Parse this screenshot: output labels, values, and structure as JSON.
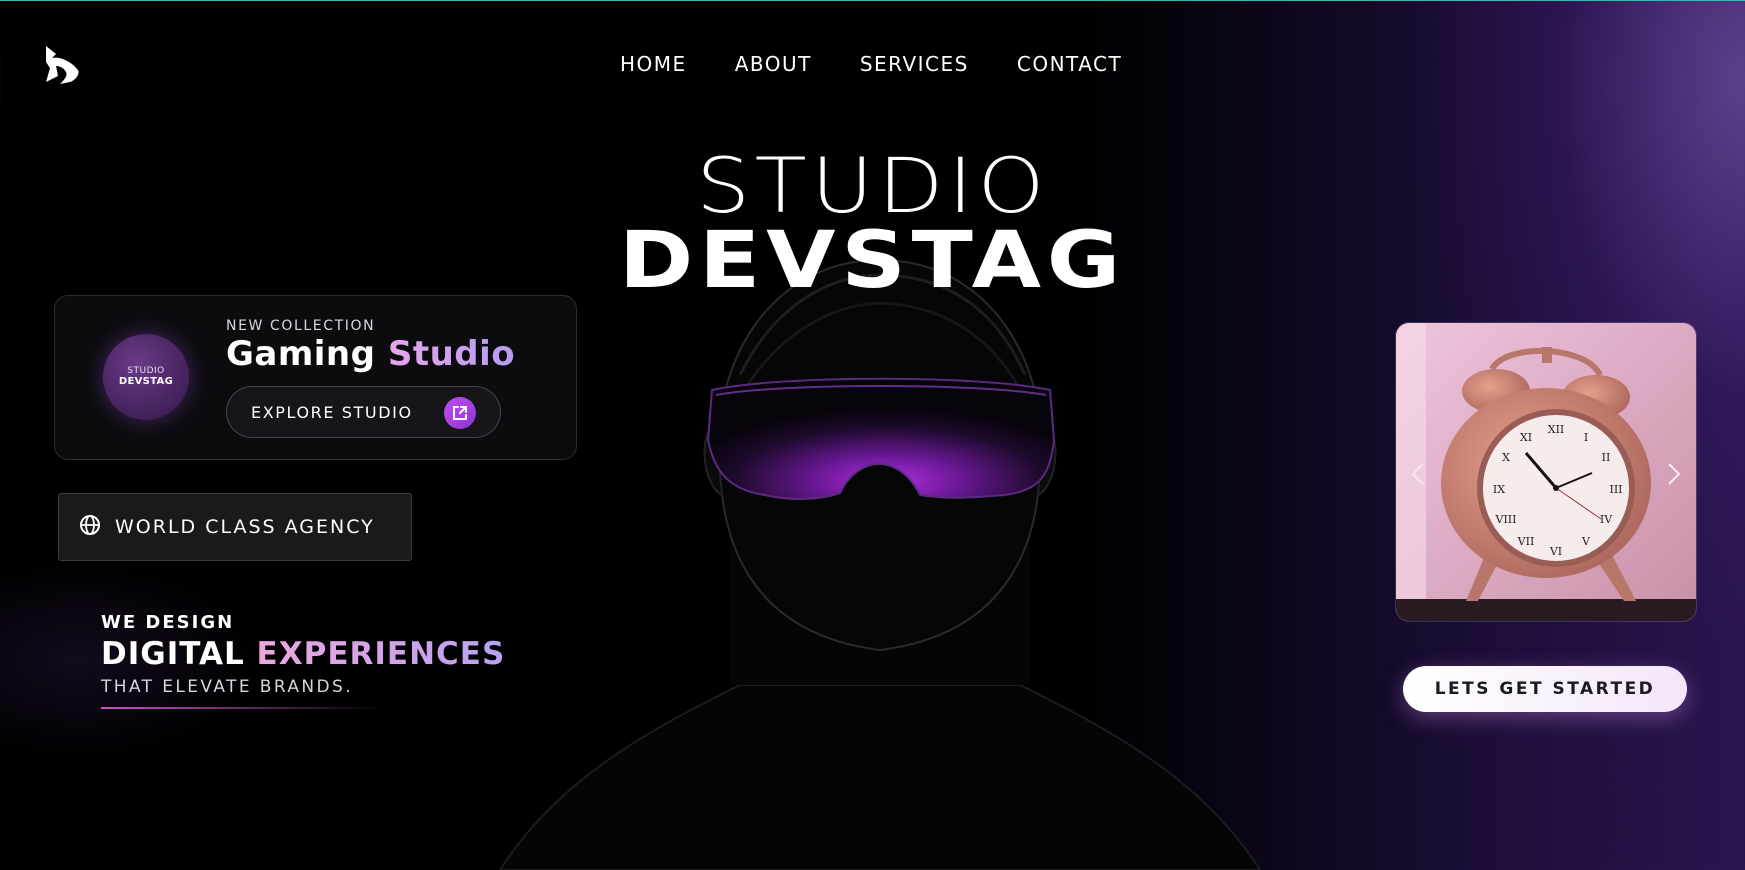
{
  "nav": {
    "items": [
      {
        "label": "HOME"
      },
      {
        "label": "ABOUT"
      },
      {
        "label": "SERVICES"
      },
      {
        "label": "CONTACT"
      }
    ]
  },
  "hero": {
    "title_top": "STUDIO",
    "title_bottom": "DEVSTAG"
  },
  "collection_card": {
    "badge_line1": "STUDIO",
    "badge_line2": "DEVSTAG",
    "eyebrow": "NEW COLLECTION",
    "heading_part1": "Gaming",
    "heading_part2": "Studio",
    "button_label": "EXPLORE STUDIO",
    "button_icon": "external-link-icon"
  },
  "agency_tag": {
    "icon": "globe-icon",
    "label": "WORLD CLASS AGENCY"
  },
  "tagline": {
    "line1": "WE DESIGN",
    "line2_part1": "DIGITAL",
    "line2_part2": "EXPERIENCES",
    "line3": "THAT ELEVATE BRANDS."
  },
  "cta": {
    "label": "LETS GET STARTED"
  },
  "colors": {
    "accent": "#c04ef0",
    "gradient_pink": "#e7a6ea",
    "gradient_lavender": "#b59df2",
    "background": "#000000",
    "purple_glow": "#2a1550"
  }
}
